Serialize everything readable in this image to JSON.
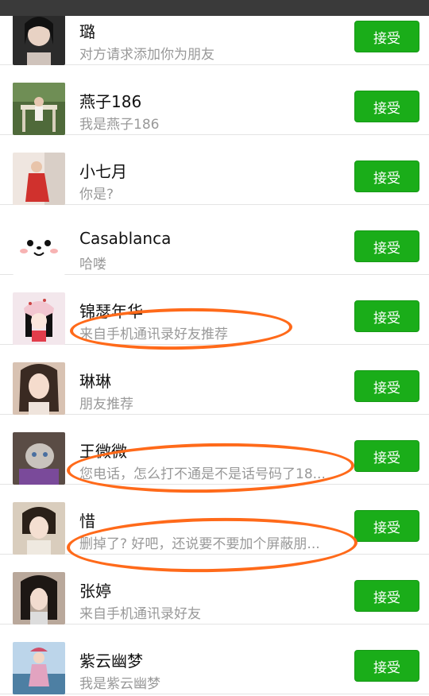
{
  "requests": [
    {
      "name": "璐",
      "message": "对方请求添加你为朋友",
      "button": "接受",
      "avatar_icon": "photo-avatar-icon",
      "bg": "#2b2b2b"
    },
    {
      "name": "燕子186",
      "message": "我是燕子186",
      "button": "接受",
      "avatar_icon": "photo-avatar-icon",
      "bg": "#4f6a3a"
    },
    {
      "name": "小七月",
      "message": "你是?",
      "button": "接受",
      "avatar_icon": "photo-avatar-icon",
      "bg": "#c98f8a"
    },
    {
      "name": "Casablanca",
      "message": "哈喽",
      "button": "接受",
      "avatar_icon": "cartoon-seal-icon",
      "bg": "#ffffff"
    },
    {
      "name": "锦瑟年华",
      "message": "来自手机通讯录好友推荐",
      "button": "接受",
      "avatar_icon": "cartoon-girl-icon",
      "bg": "#f3e7ec"
    },
    {
      "name": "琳琳",
      "message": "朋友推荐",
      "button": "接受",
      "avatar_icon": "photo-avatar-icon",
      "bg": "#d8c2b2"
    },
    {
      "name": "王微微",
      "message": "您电话，怎么打不通是不是话号码了18...",
      "button": "接受",
      "avatar_icon": "photo-avatar-icon",
      "bg": "#5a4c45"
    },
    {
      "name": "惜",
      "message": "删掉了? 好吧，还说要不要加个屏蔽朋...",
      "button": "接受",
      "avatar_icon": "photo-avatar-icon",
      "bg": "#d9cdbd"
    },
    {
      "name": "张婷",
      "message": "来自手机通讯录好友",
      "button": "接受",
      "avatar_icon": "photo-avatar-icon",
      "bg": "#b9a89b"
    },
    {
      "name": "紫云幽梦",
      "message": "我是紫云幽梦",
      "button": "接受",
      "avatar_icon": "photo-avatar-icon",
      "bg": "#4d7fa3"
    }
  ],
  "colors": {
    "accept_button": "#1aad19",
    "annotation": "#ff6a1a"
  }
}
